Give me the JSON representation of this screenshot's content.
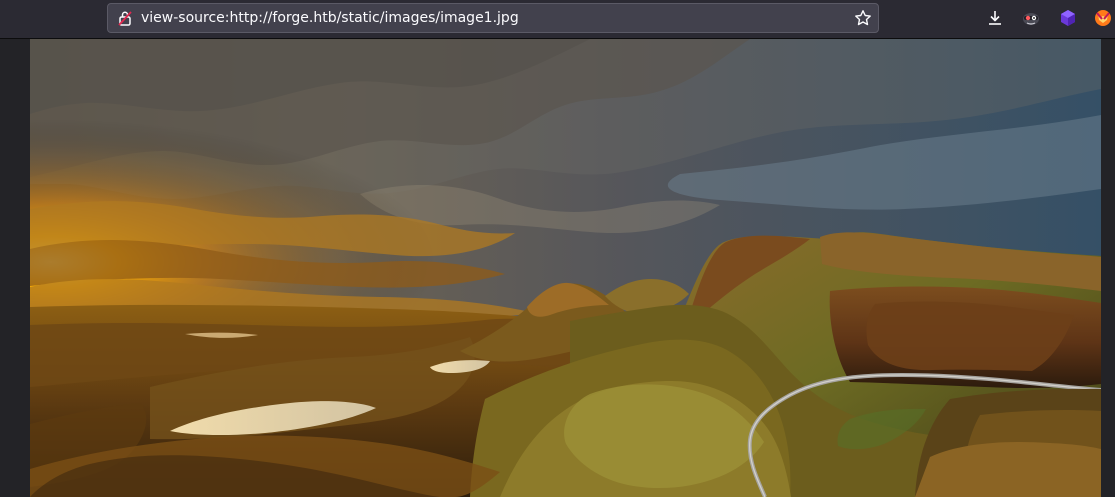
{
  "browser": {
    "url": "view-source:http://forge.htb/static/images/image1.jpg",
    "icons": {
      "site": "insecure-lock-icon",
      "bookmark": "star-icon",
      "downloads": "download-icon",
      "extension_1": "privacy-mask-icon",
      "extension_2": "purple-cube-icon",
      "extension_3": "fox-icon"
    }
  },
  "content": {
    "image_subject": "landscape-photo",
    "colors": {
      "toolbar": "#2b2a33",
      "urlbar": "#42414d",
      "page_background": "#232327",
      "sunlight": "#ffb000"
    }
  }
}
